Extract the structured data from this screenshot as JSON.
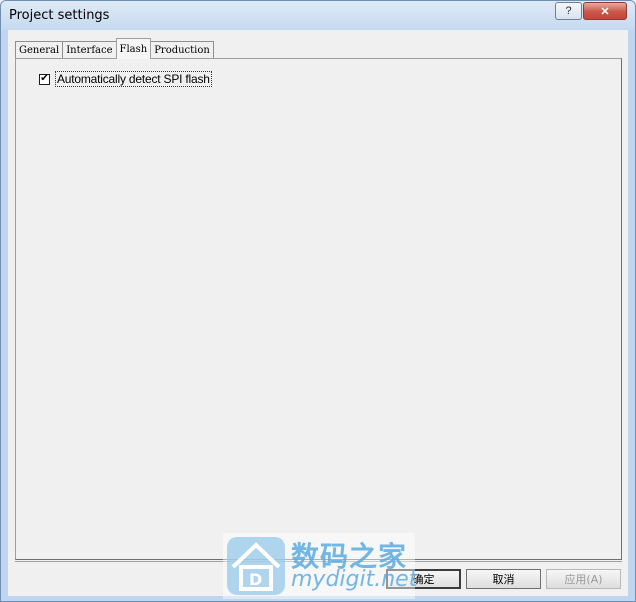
{
  "window": {
    "title": "Project settings",
    "help_label": "?",
    "close_label": "✕"
  },
  "tabs": [
    {
      "label": "General",
      "active": false
    },
    {
      "label": "Interface",
      "active": false
    },
    {
      "label": "Flash",
      "active": true
    },
    {
      "label": "Production",
      "active": false
    }
  ],
  "flash_panel": {
    "auto_detect": {
      "label": "Automatically detect SPI flash",
      "checked": true,
      "check_glyph": "✔"
    }
  },
  "buttons": {
    "ok": "确定",
    "cancel": "取消",
    "apply": "应用(A)"
  },
  "watermark": {
    "cn": "数码之家",
    "en": "mydigit.net",
    "logo": "D"
  }
}
